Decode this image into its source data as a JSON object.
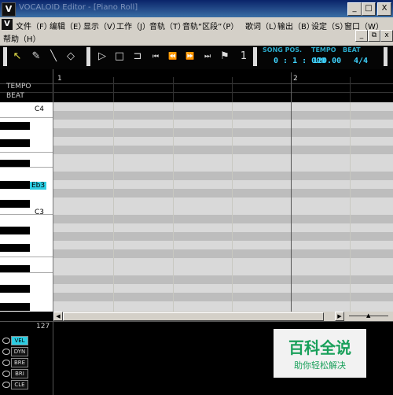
{
  "window": {
    "title": "VOCALOID Editor - [Piano Roll]",
    "minimize": "_",
    "maximize": "□",
    "close": "X"
  },
  "menu": {
    "items": [
      "文件（F）",
      "编辑（E）",
      "显示（V）",
      "工作（J）",
      "音轨（T）",
      "音轨“区段”（P）",
      "歌词（L）",
      "输出（B）",
      "设定（S）",
      "窗口（W）"
    ],
    "help": "帮助（H）",
    "mdi_min": "_",
    "mdi_restore": "⧉",
    "mdi_close": "x"
  },
  "toolbar": {
    "song_pos_label": "SONG POS.",
    "song_pos_value": "0 : 1 : 000",
    "tempo_label": "TEMPO",
    "tempo_value": "120.00",
    "beat_label": "BEAT",
    "beat_value": "4/4"
  },
  "ruler": {
    "tempo_label": "TEMPO",
    "beat_label": "BEAT",
    "bars": [
      "1",
      "2"
    ]
  },
  "piano": {
    "labels": [
      "C4",
      "Eb3",
      "C3"
    ]
  },
  "controller": {
    "max_value": "127",
    "buttons": [
      "VEL",
      "DYN",
      "BRE",
      "BRI",
      "CLE"
    ]
  },
  "watermark": {
    "title": "百科全说",
    "subtitle": "助你轻松解决"
  }
}
